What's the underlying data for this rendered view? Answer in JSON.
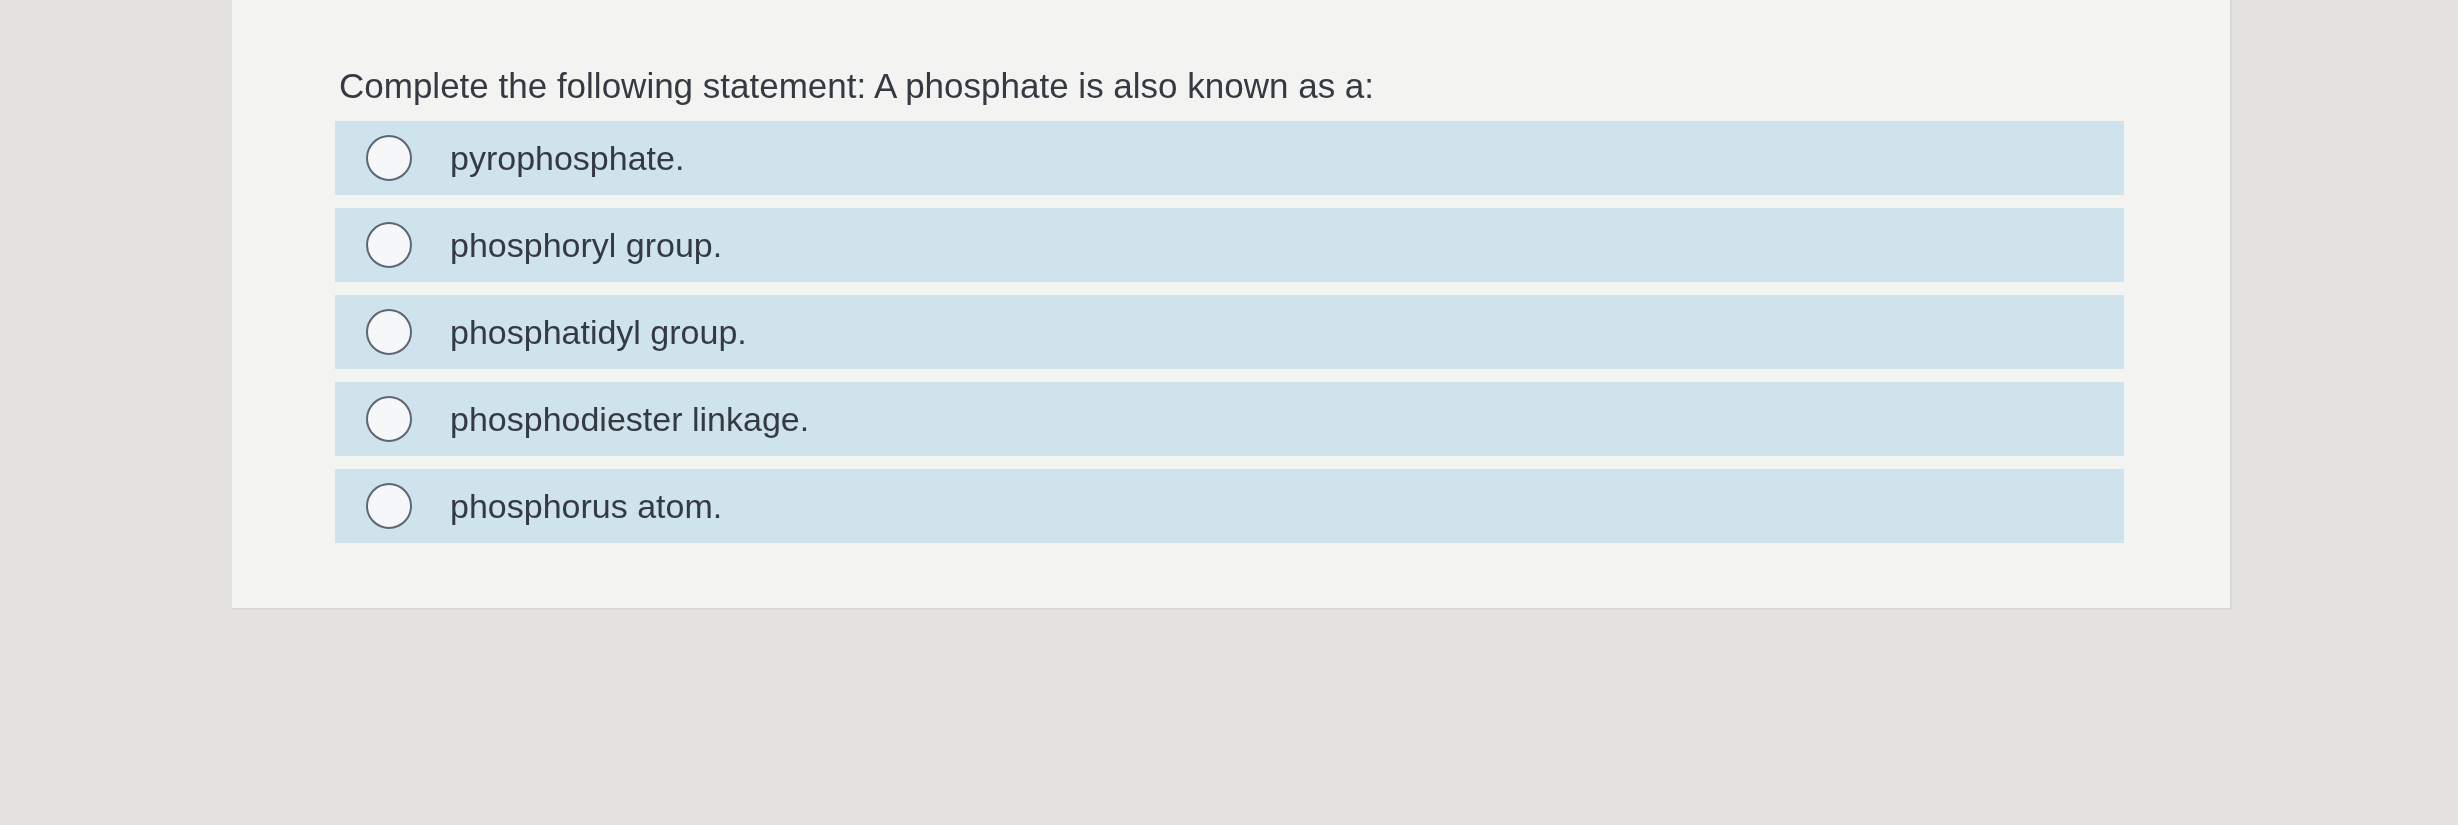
{
  "question": "Complete the following statement: A phosphate is also known as a:",
  "options": [
    {
      "label": "pyrophosphate.",
      "selected": false
    },
    {
      "label": "phosphoryl group.",
      "selected": false
    },
    {
      "label": "phosphatidyl group.",
      "selected": false
    },
    {
      "label": "phosphodiester linkage.",
      "selected": false
    },
    {
      "label": "phosphorus atom.",
      "selected": false
    }
  ]
}
